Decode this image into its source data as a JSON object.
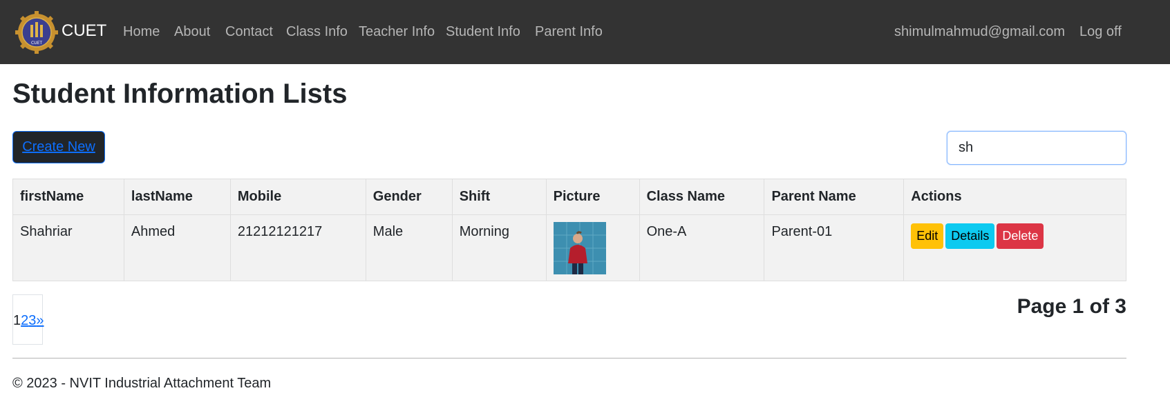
{
  "navbar": {
    "brand": "CUET",
    "logo_text": "CUET",
    "links": [
      "Home",
      "About",
      "Contact",
      "Class Info",
      "Teacher Info",
      "Student Info",
      "Parent Info"
    ],
    "user_email": "shimulmahmud@gmail.com",
    "logoff": "Log off"
  },
  "page": {
    "title": "Student Information Lists",
    "create_label": "Create New",
    "search_value": "sh"
  },
  "table": {
    "headers": [
      "firstName",
      "lastName",
      "Mobile",
      "Gender",
      "Shift",
      "Picture",
      "Class Name",
      "Parent Name",
      "Actions"
    ],
    "rows": [
      {
        "firstName": "Shahriar",
        "lastName": "Ahmed",
        "mobile": "21212121217",
        "gender": "Male",
        "shift": "Morning",
        "picture_icon": "person-photo",
        "className": "One-A",
        "parentName": "Parent-01",
        "actions": [
          "Edit",
          "Details",
          "Delete"
        ]
      }
    ]
  },
  "pagination": {
    "current": "1",
    "pages": [
      "2",
      "3"
    ],
    "next": "»",
    "summary": "Page 1 of 3"
  },
  "footer": {
    "text": "© 2023 - NVIT Industrial Attachment Team"
  },
  "colors": {
    "navbar": "#333333",
    "edit": "#ffc107",
    "details": "#0dcaf0",
    "delete": "#dc3545",
    "link": "#0d6efd"
  }
}
